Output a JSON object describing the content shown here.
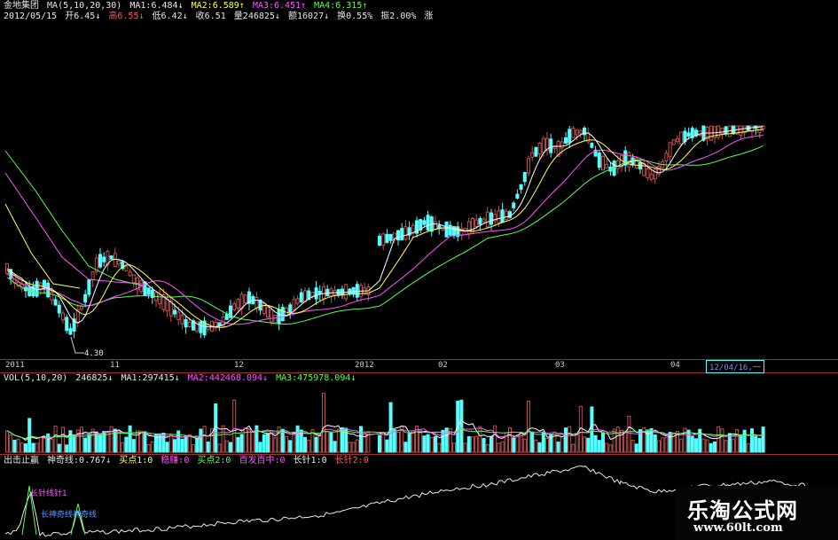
{
  "price_header": {
    "stock_name": "金地集团",
    "ma_params": "MA(5,10,20,30)",
    "ma1": "MA1:6.484↓",
    "ma2": "MA2:6.589↑",
    "ma3": "MA3:6.451↑",
    "ma4": "MA4:6.315↑",
    "date": "2012/05/15",
    "open": "开6.45↓",
    "high": "高6.55↓",
    "low": "低6.42↓",
    "close": "收6.51",
    "volume": "量246825↓",
    "amount": "额16027↓",
    "turnover": "换0.55%",
    "amplitude": "振2.00%",
    "change": "涨"
  },
  "low_marker": "4.30",
  "x_axis": [
    "2011",
    "11",
    "12",
    "2012",
    "02",
    "03",
    "04"
  ],
  "date_tag": "12/04/16,一",
  "volume_header": {
    "params": "VOL(5,10,20)",
    "vol": "246825↓",
    "ma1": "MA1:297415↓",
    "ma2": "MA2:442468.094↓",
    "ma3": "MA3:475978.094↓"
  },
  "indicator_header": {
    "name": "出击止赢",
    "shenqi": "神奇线:0.767↓",
    "buy": "买点1:0",
    "stable": "稳赚:0",
    "buy2": "买点2:0",
    "hundred": "百发百中:0",
    "needle": "长针1:0",
    "needle2": "长针2:0"
  },
  "indicator_labels": {
    "a": "长针线针1",
    "b": "长神奇线神奇线"
  },
  "watermark": {
    "cn": "乐淘公式网",
    "url": "www.60lt.com"
  },
  "colors": {
    "up": "#c05050",
    "down": "#55ffff",
    "ma5": "#ffffff",
    "ma10": "#ffff55",
    "ma20": "#ff55ff",
    "ma30": "#55ff55"
  }
}
